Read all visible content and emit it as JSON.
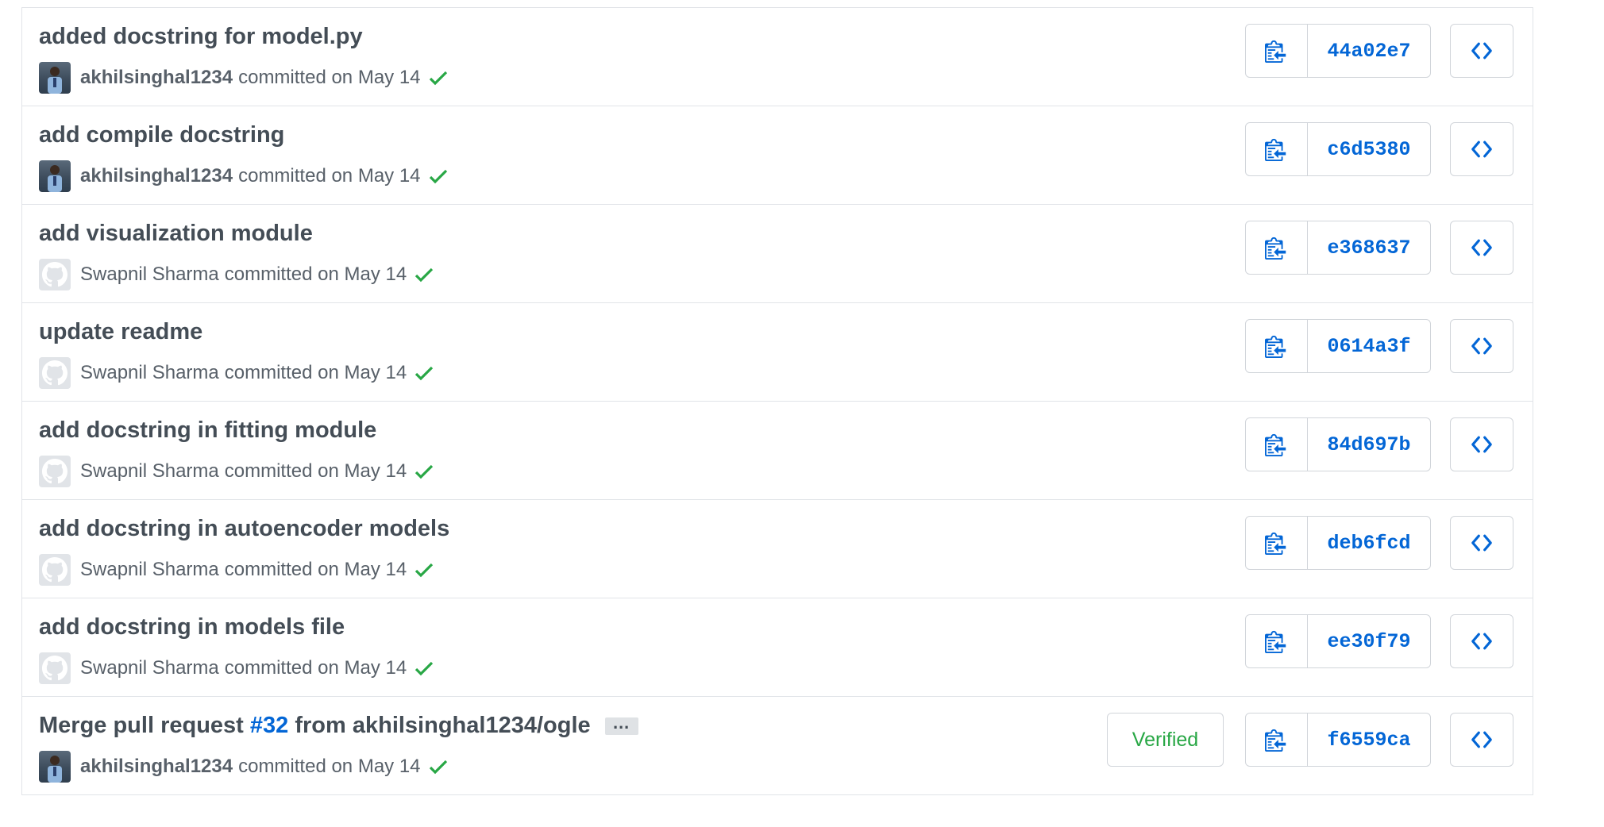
{
  "commits": [
    {
      "message": "added docstring for model.py",
      "author": "akhilsinghal1234",
      "avatar": "person",
      "committed_text": "committed on May 14",
      "sha": "44a02e7"
    },
    {
      "message": "add compile docstring",
      "author": "akhilsinghal1234",
      "avatar": "person",
      "committed_text": "committed on May 14",
      "sha": "c6d5380"
    },
    {
      "message": "add visualization module",
      "author": "Swapnil Sharma",
      "avatar": "github-default",
      "committed_text": "committed on May 14",
      "sha": "e368637"
    },
    {
      "message": "update readme",
      "author": "Swapnil Sharma",
      "avatar": "github-default",
      "committed_text": "committed on May 14",
      "sha": "0614a3f"
    },
    {
      "message": "add docstring in fitting module",
      "author": "Swapnil Sharma",
      "avatar": "github-default",
      "committed_text": "committed on May 14",
      "sha": "84d697b"
    },
    {
      "message": "add docstring in autoencoder models",
      "author": "Swapnil Sharma",
      "avatar": "github-default",
      "committed_text": "committed on May 14",
      "sha": "deb6fcd"
    },
    {
      "message": "add docstring in models file",
      "author": "Swapnil Sharma",
      "avatar": "github-default",
      "committed_text": "committed on May 14",
      "sha": "ee30f79"
    },
    {
      "message_prefix": "Merge pull request",
      "pr_number": "#32",
      "message_suffix": "from akhilsinghal1234/ogle",
      "ellipsis": "…",
      "author": "akhilsinghal1234",
      "avatar": "person",
      "committed_text": "committed on May 14",
      "sha": "f6559ca",
      "verified": "Verified"
    }
  ],
  "icons": {
    "copy": "clippy-icon",
    "browse": "code-icon",
    "status": "check-icon"
  },
  "colors": {
    "link": "#0366d6",
    "success": "#28a745",
    "border": "#e1e4e8"
  }
}
